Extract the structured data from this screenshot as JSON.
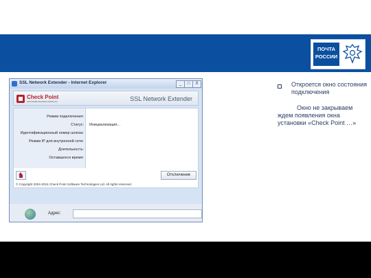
{
  "logo": {
    "line1": "ПОЧТА",
    "line2": "РОССИИ",
    "emblem_icon": "eagle-emblem-icon"
  },
  "window": {
    "title": "SSL Network Extender - Internet Explorer",
    "controls": {
      "minimize": "_",
      "maximize": "□",
      "close": "X"
    },
    "banner": {
      "brand": "Check Point",
      "brand_sub": "SOFTWARE TECHNOLOGIES LTD.",
      "product": "SSL Network Extender"
    },
    "fields": [
      {
        "label": "Режим подключения:",
        "value": ""
      },
      {
        "label": "Статус:",
        "value": "Инициализация..."
      },
      {
        "label": "Идентификационный номер шлюза:",
        "value": ""
      },
      {
        "label": "Режим IP для внутренней сети:",
        "value": ""
      },
      {
        "label": "Длительность:",
        "value": ""
      },
      {
        "label": "Оставшееся время:",
        "value": ""
      }
    ],
    "disconnect_label": "Отключение",
    "copyright": "© Copyright 2004-2015 Check Point Software Technologies Ltd. All rights reserved.",
    "address_label": "Адрес:",
    "address_value": ""
  },
  "notes": {
    "bullet_text": "Откроется окно состояния подключения",
    "body_text": "Окно не закрываем ждем появления окна установки «Check Point …»"
  },
  "colors": {
    "header_blue": "#0b4fa0",
    "checkpoint_red": "#b5222f",
    "note_text": "#2a3d63"
  }
}
